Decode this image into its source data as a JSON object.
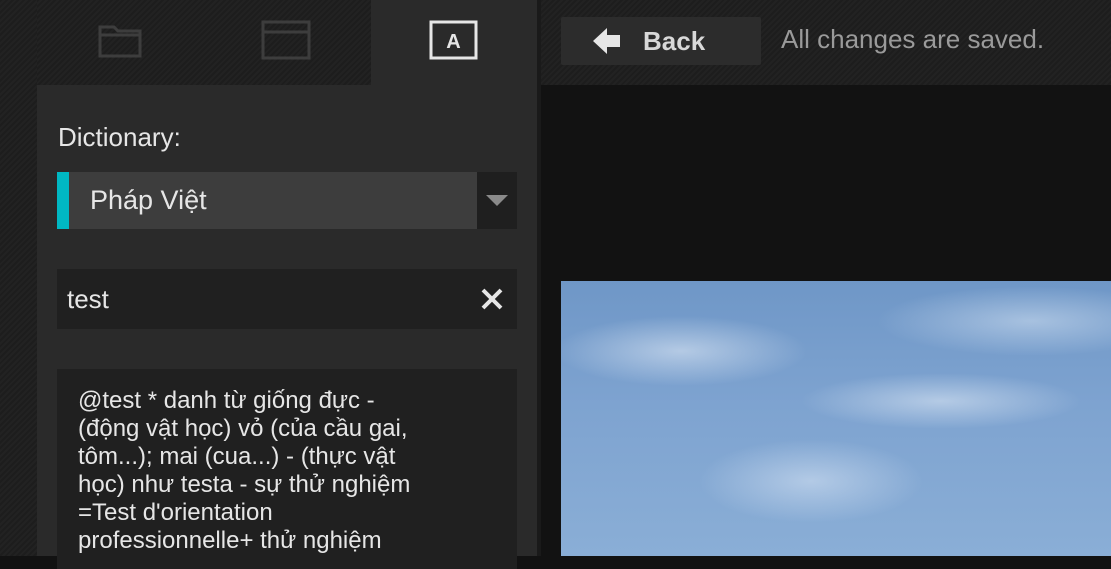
{
  "tabs": [
    {
      "icon": "folder-icon"
    },
    {
      "icon": "window-icon"
    },
    {
      "icon": "text-box-icon",
      "glyph": "A",
      "active": true
    }
  ],
  "header": {
    "back_label": "Back",
    "status": "All changes are saved."
  },
  "sidebar": {
    "dictionary_label": "Dictionary:",
    "dictionary_selected": "Pháp Việt",
    "search_value": "test",
    "result_text": "@test * danh từ giống đực -\n(động vật học) vỏ (của cầu gai,\ntôm...); mai (cua...) - (thực vật\nhọc) như testa - sự thử nghiệm\n=Test d'orientation\nprofessionnelle+ thử nghiệm"
  },
  "colors": {
    "accent": "#00b8c3",
    "panel": "#2a2a2a",
    "sky": "#7ea3d0"
  }
}
